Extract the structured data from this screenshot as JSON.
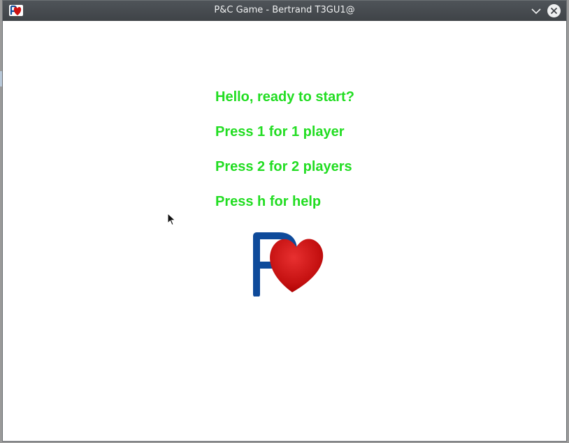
{
  "window": {
    "title": "P&C Game - Bertrand T3GU1@",
    "app_icon": "pc-heart-logo-icon",
    "minimize_icon": "chevron-down-icon",
    "close_icon": "close-icon"
  },
  "menu": {
    "lines": [
      "Hello, ready to start?",
      "Press 1 for 1 player",
      "Press 2 for 2 players",
      "Press h for help"
    ],
    "text_color": "#22dd22"
  },
  "logo": {
    "icon": "pc-heart-logo-icon",
    "letter": "P",
    "letter_color": "#0e4a9a",
    "heart_color": "#cc1111"
  },
  "colors": {
    "titlebar": "#45494d",
    "background": "#ffffff"
  }
}
